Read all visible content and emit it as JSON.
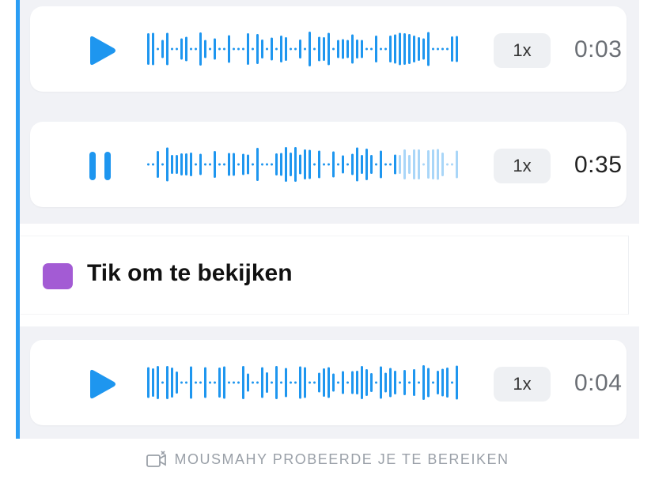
{
  "colors": {
    "accent": "#2a9df4",
    "played": "#1e96ef",
    "unplayed": "#a9d6f8",
    "snap_unopened": "#a35bd4"
  },
  "messages": [
    {
      "type": "voice",
      "state": "paused",
      "control_icon": "play-icon",
      "speed": "1x",
      "duration": "0:03",
      "played_fraction": 0
    },
    {
      "type": "voice",
      "state": "playing",
      "control_icon": "pause-icon",
      "speed": "1x",
      "duration": "0:35",
      "played_fraction": 0.8
    },
    {
      "type": "snap",
      "icon": "snap-square-icon",
      "label": "Tik om te bekijken"
    },
    {
      "type": "voice",
      "state": "paused",
      "control_icon": "play-icon",
      "speed": "1x",
      "duration": "0:04",
      "played_fraction": 0
    }
  ],
  "footer": {
    "icon": "missed-video-call-icon",
    "text": "MOUSMAHY PROBEERDE JE TE BEREIKEN"
  }
}
